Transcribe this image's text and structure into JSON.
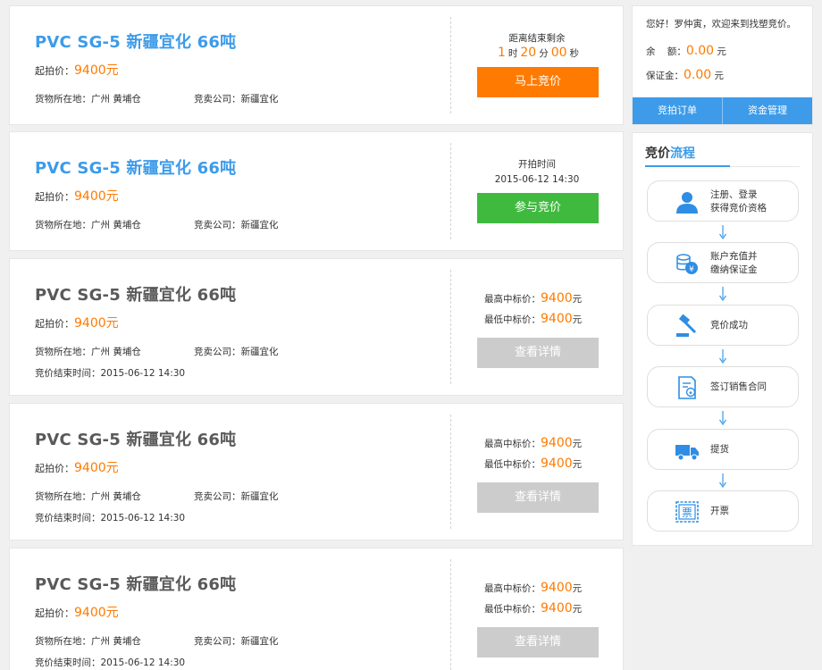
{
  "listings": [
    {
      "title": "PVC SG-5 新疆宜化 66吨",
      "start_price_label": "起拍价：",
      "start_price_value": "9400元",
      "location": "货物所在地：广州  黄埔仓",
      "company": "竞卖公司：新疆宜化",
      "countdown_label": "距离结束剩余",
      "countdown": {
        "hours": "1",
        "hours_unit": "时",
        "minutes": "20",
        "minutes_unit": "分",
        "seconds": "00",
        "seconds_unit": "秒"
      },
      "button_label": "马上竞价"
    },
    {
      "title": "PVC SG-5 新疆宜化 66吨",
      "start_price_label": "起拍价：",
      "start_price_value": "9400元",
      "location": "货物所在地：广州  黄埔仓",
      "company": "竞卖公司：新疆宜化",
      "start_time_label": "开拍时间",
      "start_time_value": "2015-06-12 14:30",
      "button_label": "参与竞价"
    },
    {
      "title": "PVC SG-5 新疆宜化 66吨",
      "start_price_label": "起拍价：",
      "start_price_value": "9400元",
      "location": "货物所在地：广州  黄埔仓",
      "company": "竞卖公司：新疆宜化",
      "end_time": "竞价结束时间：2015-06-12 14:30",
      "max_bid_label": "最高中标价：",
      "max_bid_value": "9400",
      "min_bid_label": "最低中标价：",
      "min_bid_value": "9400",
      "currency_unit": "元",
      "button_label": "查看详情"
    },
    {
      "title": "PVC SG-5 新疆宜化 66吨",
      "start_price_label": "起拍价：",
      "start_price_value": "9400元",
      "location": "货物所在地：广州  黄埔仓",
      "company": "竞卖公司：新疆宜化",
      "end_time": "竞价结束时间：2015-06-12 14:30",
      "max_bid_label": "最高中标价：",
      "max_bid_value": "9400",
      "min_bid_label": "最低中标价：",
      "min_bid_value": "9400",
      "currency_unit": "元",
      "button_label": "查看详情"
    },
    {
      "title": "PVC SG-5 新疆宜化 66吨",
      "start_price_label": "起拍价：",
      "start_price_value": "9400元",
      "location": "货物所在地：广州  黄埔仓",
      "company": "竞卖公司：新疆宜化",
      "end_time": "竞价结束时间：2015-06-12 14:30",
      "max_bid_label": "最高中标价：",
      "max_bid_value": "9400",
      "min_bid_label": "最低中标价：",
      "min_bid_value": "9400",
      "currency_unit": "元",
      "button_label": "查看详情"
    }
  ],
  "user_panel": {
    "greeting": "您好！罗仲寅，欢迎来到找塑竞价。",
    "balance_label": "余    额：",
    "balance_value": "0.00",
    "deposit_label": "保证金：",
    "deposit_value": "0.00",
    "currency_unit": "元",
    "tabs": [
      "竞拍订单",
      "资金管理"
    ]
  },
  "process_panel": {
    "heading_main": "竞价",
    "heading_highlight": "流程",
    "steps": [
      {
        "icon": "user-icon",
        "line1": "注册、登录",
        "line2": "获得竞价资格"
      },
      {
        "icon": "coins-icon",
        "line1": "账户充值并",
        "line2": "缴纳保证金"
      },
      {
        "icon": "gavel-icon",
        "line1": "竞价成功",
        "line2": ""
      },
      {
        "icon": "contract-icon",
        "line1": "签订销售合同",
        "line2": ""
      },
      {
        "icon": "truck-icon",
        "line1": "提货",
        "line2": ""
      },
      {
        "icon": "invoice-icon",
        "line1": "开票",
        "line2": ""
      }
    ]
  },
  "colors": {
    "accent_blue": "#3d9be9",
    "price_orange": "#ff7a00",
    "button_green": "#3fba3f",
    "button_gray": "#cccccc"
  }
}
